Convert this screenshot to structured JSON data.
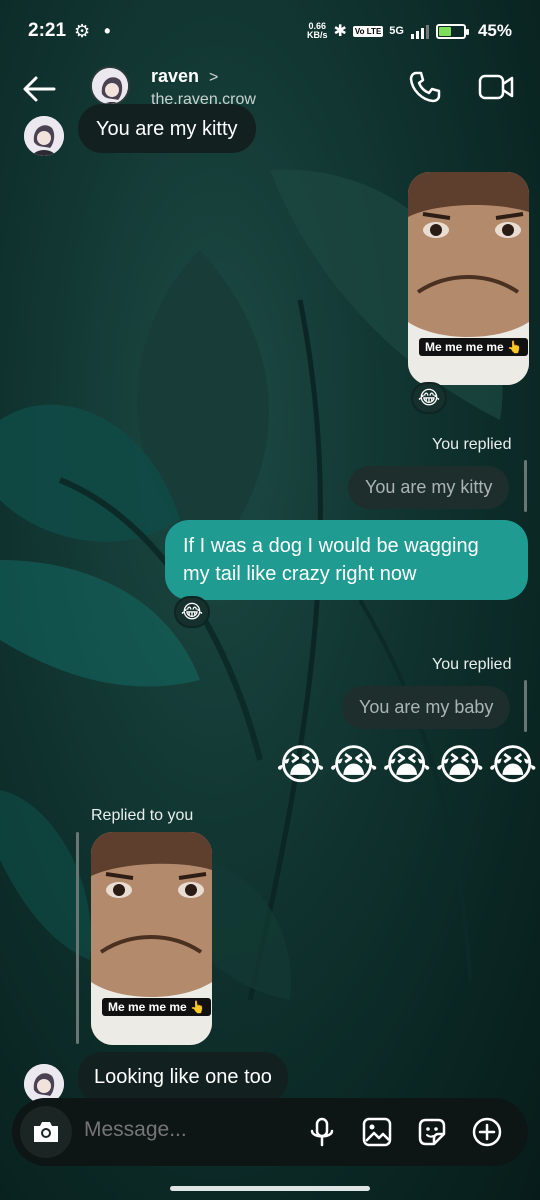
{
  "status_bar": {
    "time": "2:21",
    "gear_icon": "settings-gear",
    "dot": "•",
    "net_speed_value": "0.66",
    "net_speed_unit": "KB/s",
    "volte": "Vo LTE",
    "signal": "5G",
    "battery_percent": "45%",
    "battery_level": 0.45
  },
  "header": {
    "name": "raven",
    "chevron": ">",
    "handle": "the.raven.crow"
  },
  "messages": {
    "m1_text": "You are my kitty",
    "photo1_sticker": "Me me me me 👆",
    "photo1_reaction": "😂",
    "reply1_label": "You replied",
    "reply1_quote": "You are my kitty",
    "teal_message": "If I was a dog I would be wagging my tail like crazy right now",
    "teal_reaction": "😂",
    "reply2_label": "You replied",
    "reply2_quote": "You are my baby",
    "emoji_row": "😭😭😭😭😭",
    "replied_to_you_label": "Replied to you",
    "photo2_sticker": "Me me me me 👆",
    "last_message": "Looking like one too"
  },
  "composer": {
    "placeholder": "Message..."
  },
  "colors": {
    "teal_bubble": "#1f9b91",
    "dark_bubble": "#12211f",
    "background": "#0b2e2a"
  }
}
